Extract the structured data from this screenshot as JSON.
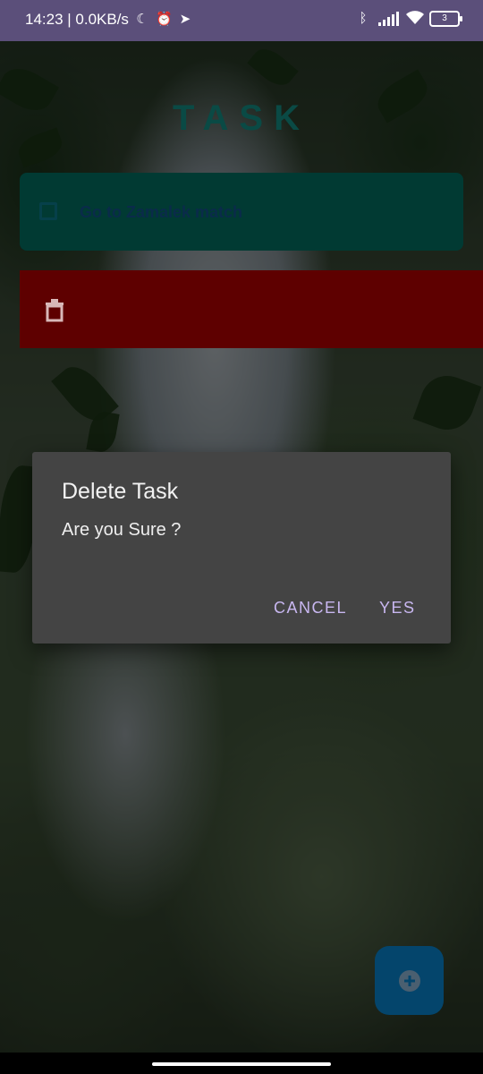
{
  "status_bar": {
    "time_speed": "14:23 | 0.0KB/s",
    "battery_level": "3"
  },
  "app": {
    "title": "TASK"
  },
  "task_list": [
    {
      "title": "Go to Zamalek match",
      "completed": false
    }
  ],
  "dialog": {
    "title": "Delete Task",
    "message": "Are you Sure ?",
    "cancel_label": "CANCEL",
    "confirm_label": "YES"
  },
  "colors": {
    "status_bar": "#5b4f7a",
    "task_card": "#013a33",
    "delete_background": "#5e0000",
    "dialog_background": "#444444",
    "dialog_button_text": "#c8b7f0",
    "fab": "#04456c"
  },
  "icons": {
    "delete": "trash-icon",
    "fab": "add-circle-icon"
  }
}
